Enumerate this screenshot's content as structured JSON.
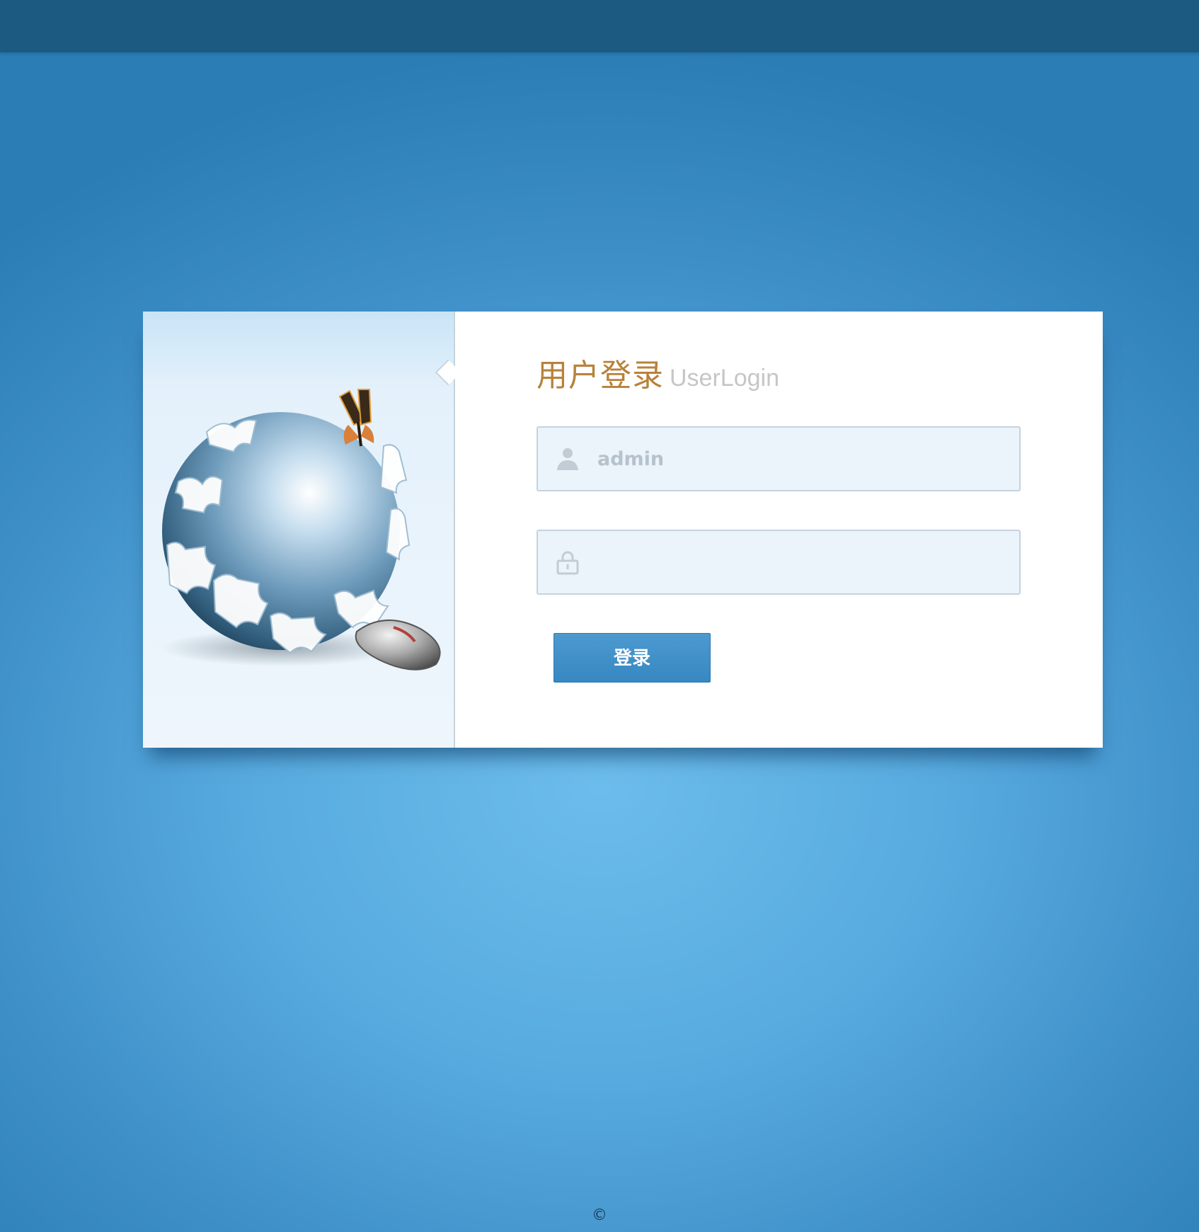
{
  "header": {},
  "login": {
    "title_cn": "用户登录",
    "title_en": "UserLogin",
    "username": {
      "value": "admin",
      "icon": "user-icon"
    },
    "password": {
      "value": "",
      "icon": "lock-icon"
    },
    "submit_label": "登录"
  },
  "illustration": {
    "subject": "puzzle-globe-icon"
  },
  "footer": {
    "copyright": "©"
  },
  "colors": {
    "top_bar": "#1c5a82",
    "background": "#58abdf",
    "title_accent": "#b8823a",
    "button": "#3787c1"
  }
}
